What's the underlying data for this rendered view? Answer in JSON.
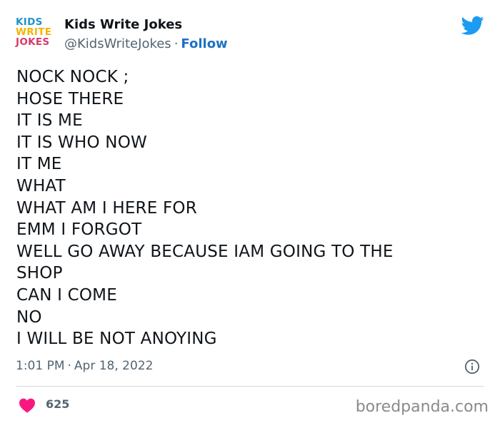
{
  "account": {
    "logo_lines": [
      "KIDS",
      "WRITE",
      "JOKES"
    ],
    "name": "Kids Write Jokes",
    "handle": "@KidsWriteJokes",
    "separator": "·",
    "follow_label": "Follow"
  },
  "icons": {
    "brand": "twitter-bird-icon",
    "info": "info-icon",
    "like": "heart-icon"
  },
  "colors": {
    "twitter_blue": "#1d9bf0",
    "follow_blue": "#1d71c4",
    "like_pink": "#f91880",
    "logo_blue": "#1f93c9",
    "logo_yellow": "#f2b400",
    "logo_pink": "#d63a6b"
  },
  "tweet": {
    "lines": [
      "NOCK NOCK ;",
      "HOSE THERE",
      "IT IS ME",
      "IT IS WHO NOW",
      "IT ME",
      "WHAT",
      "WHAT AM I HERE FOR",
      "EMM I FORGOT",
      "WELL GO AWAY BECAUSE IAM GOING TO THE",
      "SHOP",
      "CAN I COME",
      "NO",
      "I WILL BE NOT ANOYING"
    ],
    "time": "1:01 PM",
    "date": "Apr 18, 2022",
    "meta_separator": "·"
  },
  "engagement": {
    "likes": "625"
  },
  "watermark": "boredpanda.com"
}
